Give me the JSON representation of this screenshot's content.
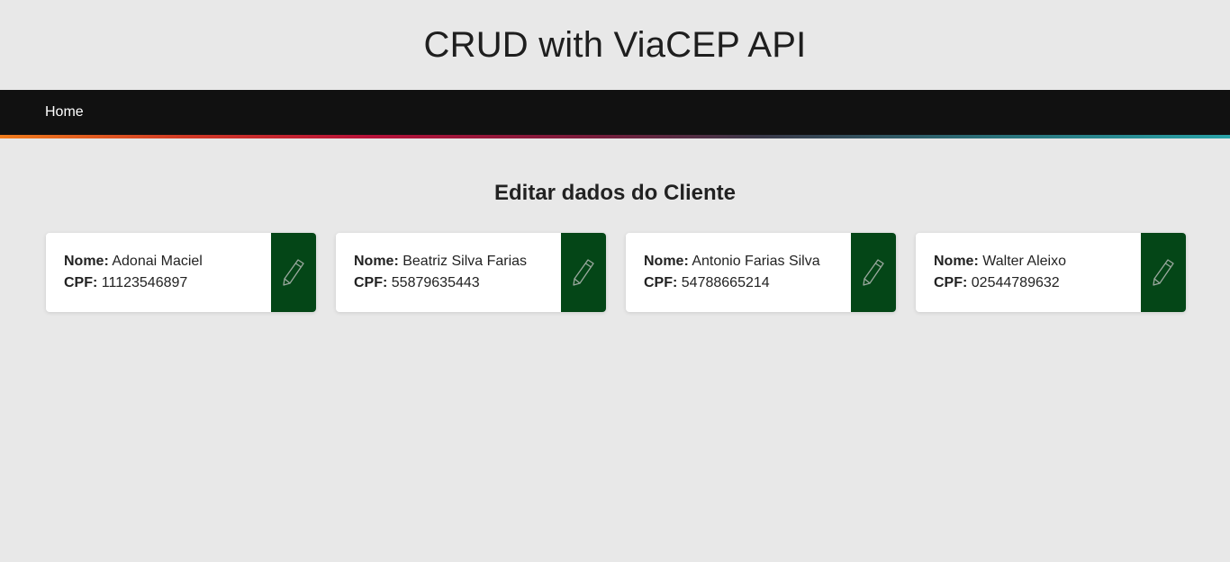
{
  "header": {
    "title": "CRUD with ViaCEP API"
  },
  "nav": {
    "home_label": "Home"
  },
  "page": {
    "section_title": "Editar dados do Cliente"
  },
  "labels": {
    "name": "Nome:",
    "cpf": "CPF:"
  },
  "icons": {
    "edit": "pencil-icon"
  },
  "colors": {
    "edit_button_bg": "#044617",
    "navbar_bg": "#111111"
  },
  "clients": [
    {
      "name": "Adonai Maciel",
      "cpf": "11123546897"
    },
    {
      "name": "Beatriz Silva Farias",
      "cpf": "55879635443"
    },
    {
      "name": "Antonio Farias Silva",
      "cpf": "54788665214"
    },
    {
      "name": "Walter Aleixo",
      "cpf": "02544789632"
    }
  ]
}
